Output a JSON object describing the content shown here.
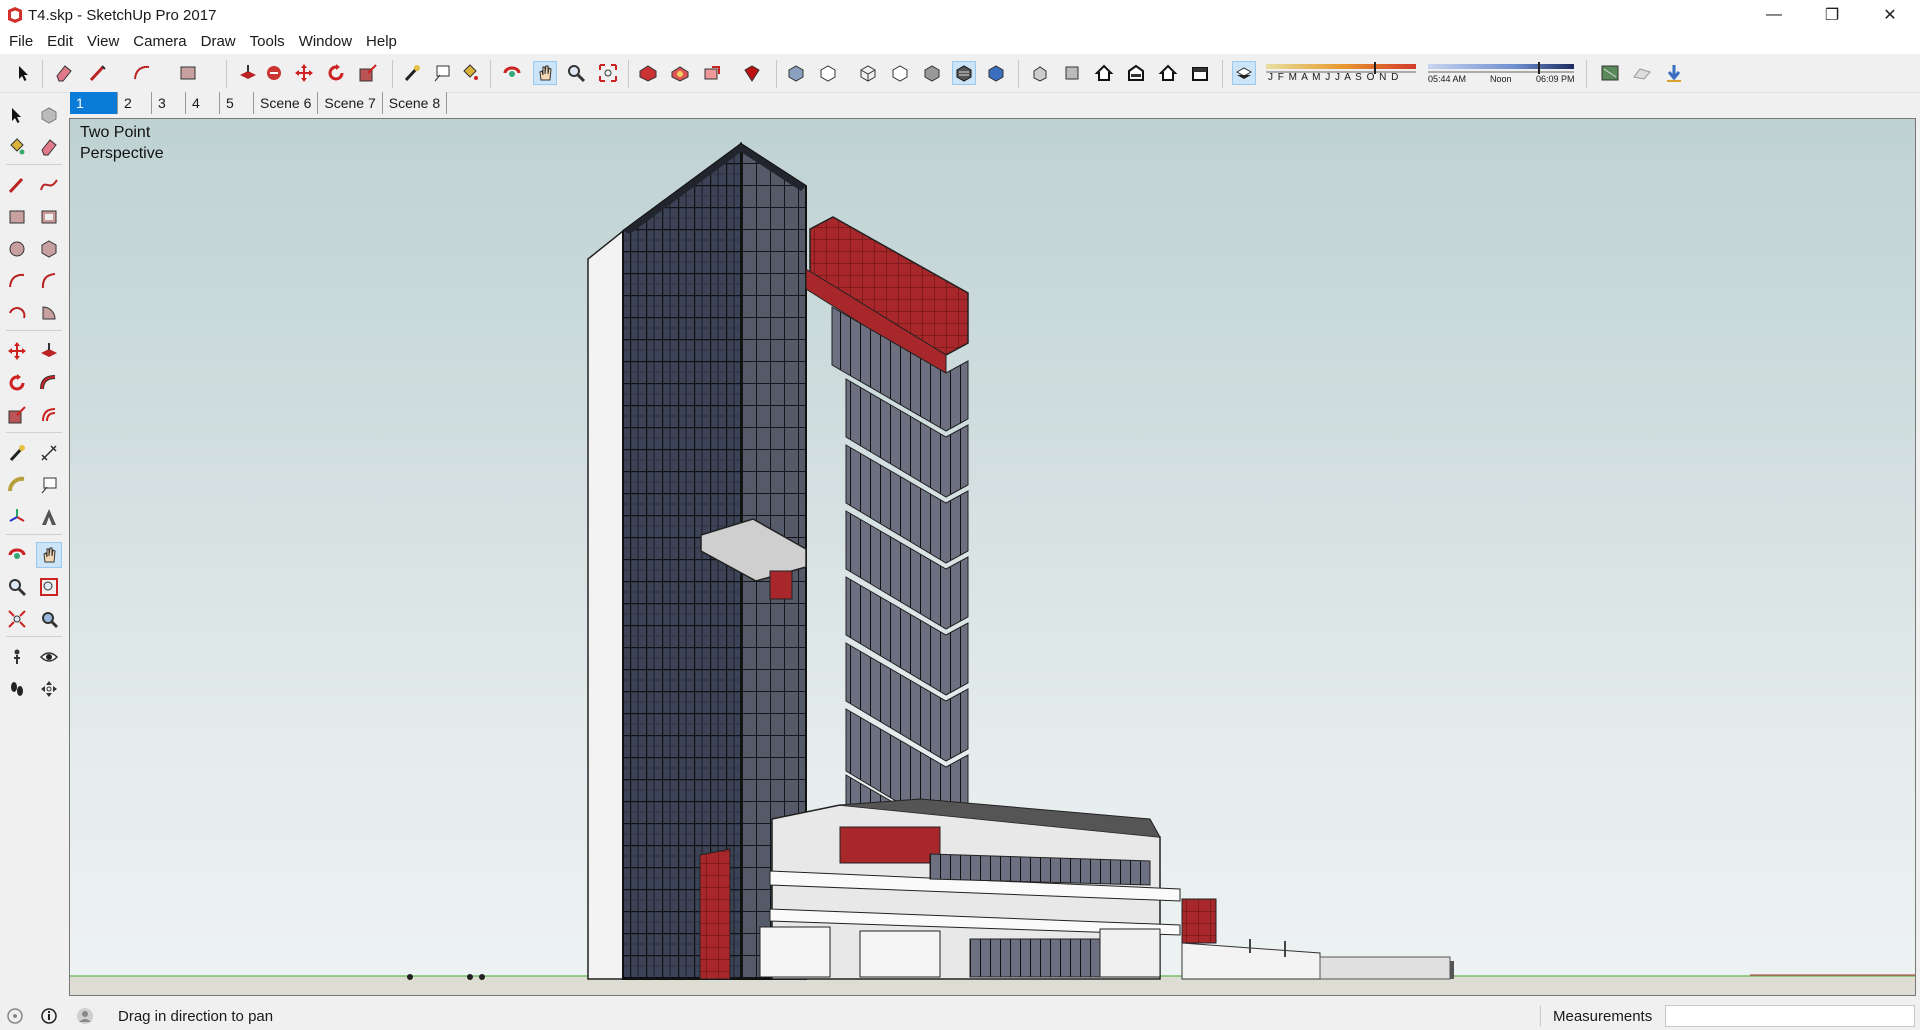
{
  "window": {
    "title": "T4.skp - SketchUp Pro 2017",
    "controls": {
      "minimize": "—",
      "maximize": "❐",
      "close": "✕"
    }
  },
  "menu": [
    "File",
    "Edit",
    "View",
    "Camera",
    "Draw",
    "Tools",
    "Window",
    "Help"
  ],
  "shadow_bar": {
    "months": "J F M A M J J A S O N D",
    "time_start": "05:44 AM",
    "time_mid": "Noon",
    "time_end": "06:09 PM"
  },
  "scenes": {
    "active_index": 0,
    "tabs": [
      "1",
      "2",
      "3",
      "4",
      "5",
      "Scene 6",
      "Scene 7",
      "Scene 8"
    ]
  },
  "viewport": {
    "camera_label_line1": "Two Point",
    "camera_label_line2": "Perspective"
  },
  "status": {
    "hint": "Drag in direction to pan",
    "measurements_label": "Measurements",
    "measurements_value": ""
  },
  "colors": {
    "sky_top": "#bfd2d2",
    "accent_red": "#b12a2a",
    "glass_dark": "#2a2e3a",
    "active_tab": "#0b7bd8"
  }
}
